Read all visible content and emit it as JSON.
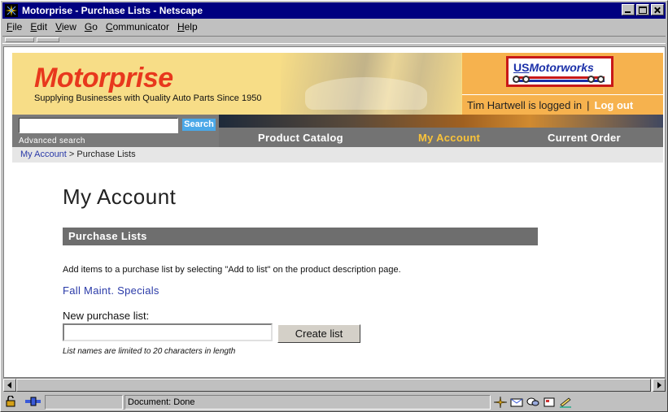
{
  "window": {
    "title": "Motorprise - Purchase Lists - Netscape"
  },
  "menu": [
    {
      "label": "File",
      "accel": "F",
      "rest": "ile"
    },
    {
      "label": "Edit",
      "accel": "E",
      "rest": "dit"
    },
    {
      "label": "View",
      "accel": "V",
      "rest": "iew"
    },
    {
      "label": "Go",
      "accel": "G",
      "rest": "o"
    },
    {
      "label": "Communicator",
      "accel": "C",
      "rest": "ommunicator"
    },
    {
      "label": "Help",
      "accel": "H",
      "rest": "elp"
    }
  ],
  "header": {
    "logo": "Motorprise",
    "tagline": "Supplying Businesses with Quality Auto Parts Since 1950",
    "partner_us": "US",
    "partner_name": "Motorworks",
    "user_status": "Tim Hartwell is logged in",
    "separator": "|",
    "logout": "Log out"
  },
  "search": {
    "value": "",
    "button": "Search",
    "advanced": "Advanced search"
  },
  "nav": {
    "items": [
      "Product Catalog",
      "My Account",
      "Current Order"
    ],
    "active": "My Account"
  },
  "breadcrumb": {
    "parent": "My Account",
    "separator": ">",
    "current": "Purchase Lists"
  },
  "main": {
    "heading": "My Account",
    "section_title": "Purchase Lists",
    "instructions": "Add items to a purchase list by selecting \"Add to list\" on the product description page.",
    "lists": [
      "Fall Maint. Specials"
    ],
    "new_list_label": "New purchase list:",
    "new_list_value": "",
    "create_button": "Create list",
    "note": "List names are limited to 20 characters in length"
  },
  "status": {
    "text": "Document: Done"
  },
  "colors": {
    "logo_red": "#e8381d",
    "header_yellow": "#f7dd87",
    "header_orange": "#f6b24e",
    "nav_gray": "#737373",
    "nav_active": "#f9c33a",
    "link_blue": "#2a3aa8",
    "search_blue": "#4aa8e8"
  },
  "icons": [
    "netscape-app-icon",
    "minimize-icon",
    "maximize-icon",
    "close-icon",
    "lock-icon",
    "connection-icon",
    "navigator-icon",
    "mail-icon",
    "discussion-icon",
    "composer-icon",
    "address-book-icon"
  ]
}
